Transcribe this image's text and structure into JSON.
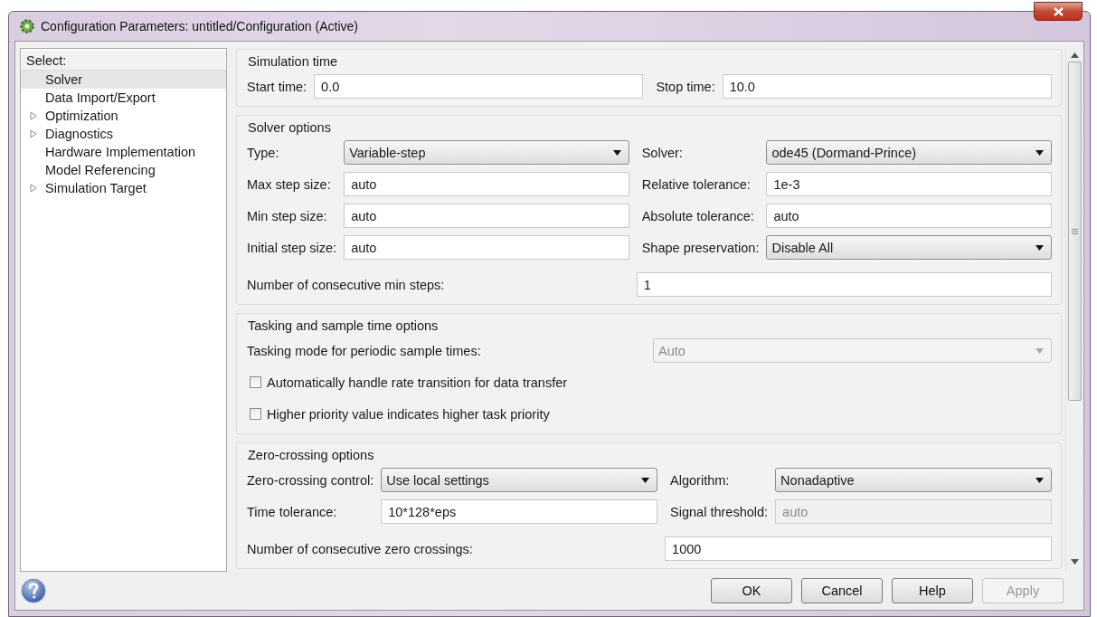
{
  "window": {
    "title": "Configuration Parameters: untitled/Configuration (Active)"
  },
  "sidebar": {
    "header": "Select:",
    "items": [
      {
        "label": "Solver",
        "kind": "leaf",
        "selected": true
      },
      {
        "label": "Data Import/Export",
        "kind": "leaf",
        "selected": false
      },
      {
        "label": "Optimization",
        "kind": "group",
        "selected": false
      },
      {
        "label": "Diagnostics",
        "kind": "group",
        "selected": false
      },
      {
        "label": "Hardware Implementation",
        "kind": "leaf",
        "selected": false
      },
      {
        "label": "Model Referencing",
        "kind": "leaf",
        "selected": false
      },
      {
        "label": "Simulation Target",
        "kind": "group",
        "selected": false
      }
    ]
  },
  "sections": [
    {
      "title": "Simulation time",
      "rows": [
        {
          "kind": "pair",
          "fields": [
            {
              "label": "Start time:",
              "kind": "text",
              "value": "0.0",
              "disabled": false
            },
            {
              "label": "Stop time:",
              "kind": "text",
              "value": "10.0",
              "disabled": false
            }
          ]
        }
      ]
    },
    {
      "title": "Solver options",
      "rows": [
        {
          "kind": "pair",
          "fields": [
            {
              "label": "Type:",
              "kind": "dropdown",
              "value": "Variable-step",
              "disabled": false
            },
            {
              "label": "Solver:",
              "kind": "dropdown",
              "value": "ode45 (Dormand-Prince)",
              "disabled": false
            }
          ]
        },
        {
          "kind": "pair",
          "fields": [
            {
              "label": "Max step size:",
              "kind": "text",
              "value": "auto",
              "disabled": false
            },
            {
              "label": "Relative tolerance:",
              "kind": "text",
              "value": "1e-3",
              "disabled": false
            }
          ]
        },
        {
          "kind": "pair",
          "fields": [
            {
              "label": "Min step size:",
              "kind": "text",
              "value": "auto",
              "disabled": false
            },
            {
              "label": "Absolute tolerance:",
              "kind": "text",
              "value": "auto",
              "disabled": false
            }
          ]
        },
        {
          "kind": "pair",
          "fields": [
            {
              "label": "Initial step size:",
              "kind": "text",
              "value": "auto",
              "disabled": false
            },
            {
              "label": "Shape preservation:",
              "kind": "dropdown",
              "value": "Disable All",
              "disabled": false
            }
          ]
        },
        {
          "kind": "wide",
          "label": "Number of consecutive min steps:",
          "field": {
            "kind": "text",
            "value": "1",
            "disabled": false
          }
        }
      ]
    },
    {
      "title": "Tasking and sample time options",
      "rows": [
        {
          "kind": "wide",
          "label": "Tasking mode for periodic sample times:",
          "field": {
            "kind": "dropdown",
            "value": "Auto",
            "disabled": true
          }
        },
        {
          "kind": "checkbox",
          "label": "Automatically handle rate transition for data transfer",
          "checked": false
        },
        {
          "kind": "checkbox",
          "label": "Higher priority value indicates higher task priority",
          "checked": false
        }
      ]
    },
    {
      "title": "Zero-crossing options",
      "rows": [
        {
          "kind": "pair",
          "fields": [
            {
              "label": "Zero-crossing control:",
              "kind": "dropdown",
              "value": "Use local settings",
              "disabled": false
            },
            {
              "label": "Algorithm:",
              "kind": "dropdown",
              "value": "Nonadaptive",
              "disabled": false
            }
          ]
        },
        {
          "kind": "pair",
          "fields": [
            {
              "label": "Time tolerance:",
              "kind": "text",
              "value": "10*128*eps",
              "disabled": false
            },
            {
              "label": "Signal threshold:",
              "kind": "text",
              "value": "auto",
              "disabled": true
            }
          ]
        },
        {
          "kind": "wide",
          "label": "Number of consecutive zero crossings:",
          "field": {
            "kind": "text",
            "value": "1000",
            "disabled": false
          }
        }
      ]
    }
  ],
  "buttons": [
    {
      "label": "OK",
      "disabled": false
    },
    {
      "label": "Cancel",
      "disabled": false
    },
    {
      "label": "Help",
      "disabled": false
    },
    {
      "label": "Apply",
      "disabled": true
    }
  ]
}
